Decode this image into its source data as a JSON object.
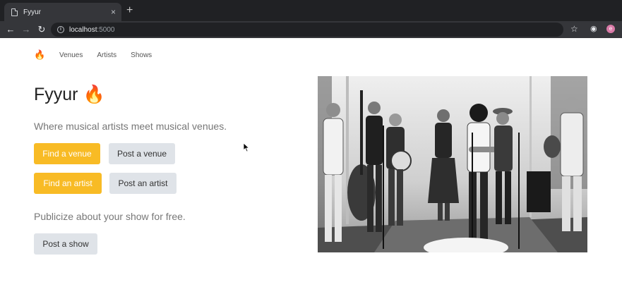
{
  "browser": {
    "tab_title": "Fyyur",
    "new_tab": "+",
    "tab_close": "×",
    "url_host": "localhost",
    "url_port": ":5000",
    "profile_initial": "e"
  },
  "nav": {
    "brand": "🔥",
    "links": [
      "Venues",
      "Artists",
      "Shows"
    ]
  },
  "hero": {
    "title": "Fyyur 🔥",
    "lead": "Where musical artists meet musical venues.",
    "lead2": "Publicize about your show for free.",
    "buttons": {
      "find_venue": "Find a venue",
      "post_venue": "Post a venue",
      "find_artist": "Find an artist",
      "post_artist": "Post an artist",
      "post_show": "Post a show"
    }
  },
  "colors": {
    "primary_button": "#f8bb25",
    "secondary_button": "#dfe3e8"
  }
}
